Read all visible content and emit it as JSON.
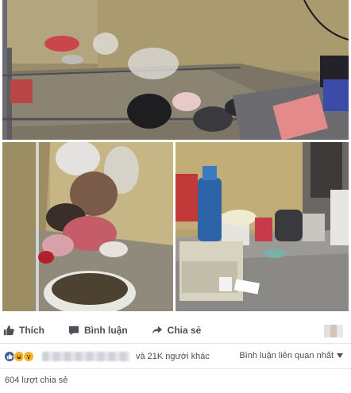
{
  "post": {
    "photos": [
      {
        "name": "dorm-bed-with-trash",
        "alt": ""
      },
      {
        "name": "corner-trash-pile",
        "alt": ""
      },
      {
        "name": "desk-with-clutter",
        "alt": ""
      }
    ]
  },
  "actions": {
    "like_label": "Thích",
    "comment_label": "Bình luận",
    "share_label": "Chia sẻ"
  },
  "reactions": {
    "icons": [
      "like-icon",
      "haha-icon",
      "wow-icon"
    ],
    "others_text": "và 21K người khác",
    "comment_filter": "Bình luận liên quan nhất"
  },
  "shares_text": "604 lượt chia sẻ",
  "colors": {
    "action_text": "#4b4f56",
    "like_blue": "#3b5998",
    "reaction_yellow": "#f7b125",
    "divider": "#e5e6e9"
  }
}
